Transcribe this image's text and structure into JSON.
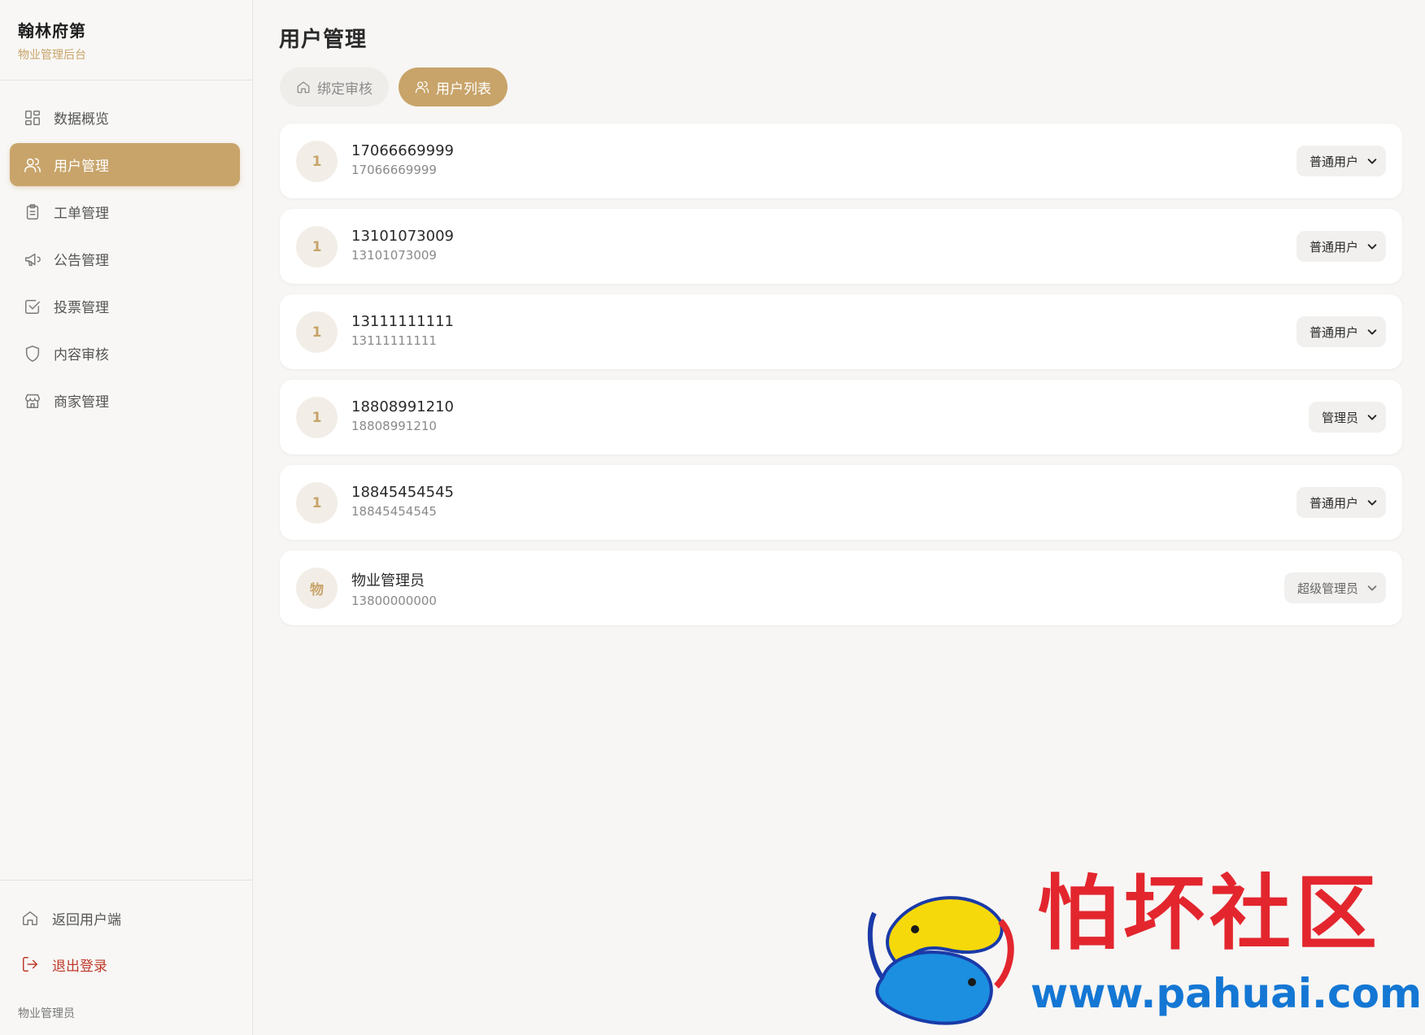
{
  "brand": {
    "title": "翰林府第",
    "subtitle": "物业管理后台"
  },
  "sidebar": {
    "items": [
      {
        "label": "数据概览",
        "icon": "grid-icon"
      },
      {
        "label": "用户管理",
        "icon": "users-icon",
        "active": true
      },
      {
        "label": "工单管理",
        "icon": "clipboard-icon"
      },
      {
        "label": "公告管理",
        "icon": "megaphone-icon"
      },
      {
        "label": "投票管理",
        "icon": "checkbox-icon"
      },
      {
        "label": "内容审核",
        "icon": "shield-icon"
      },
      {
        "label": "商家管理",
        "icon": "store-icon"
      }
    ],
    "footer": {
      "back_label": "返回用户端",
      "logout_label": "退出登录",
      "current_user": "物业管理员"
    }
  },
  "main": {
    "title": "用户管理",
    "tabs": [
      {
        "label": "绑定审核",
        "icon": "home-icon",
        "active": false
      },
      {
        "label": "用户列表",
        "icon": "users-icon",
        "active": true
      }
    ],
    "users": [
      {
        "avatar": "1",
        "name": "17066669999",
        "phone": "17066669999",
        "role": "普通用户"
      },
      {
        "avatar": "1",
        "name": "13101073009",
        "phone": "13101073009",
        "role": "普通用户"
      },
      {
        "avatar": "1",
        "name": "13111111111",
        "phone": "13111111111",
        "role": "普通用户"
      },
      {
        "avatar": "1",
        "name": "18808991210",
        "phone": "18808991210",
        "role": "管理员"
      },
      {
        "avatar": "1",
        "name": "18845454545",
        "phone": "18845454545",
        "role": "普通用户"
      },
      {
        "avatar": "物",
        "name": "物业管理员",
        "phone": "13800000000",
        "role": "超级管理员"
      }
    ]
  },
  "watermark": {
    "text": "怕坏社区",
    "url": "www.pahuai.com"
  },
  "colors": {
    "accent": "#c8a46a",
    "danger": "#c0392b",
    "background": "#f7f6f4"
  }
}
